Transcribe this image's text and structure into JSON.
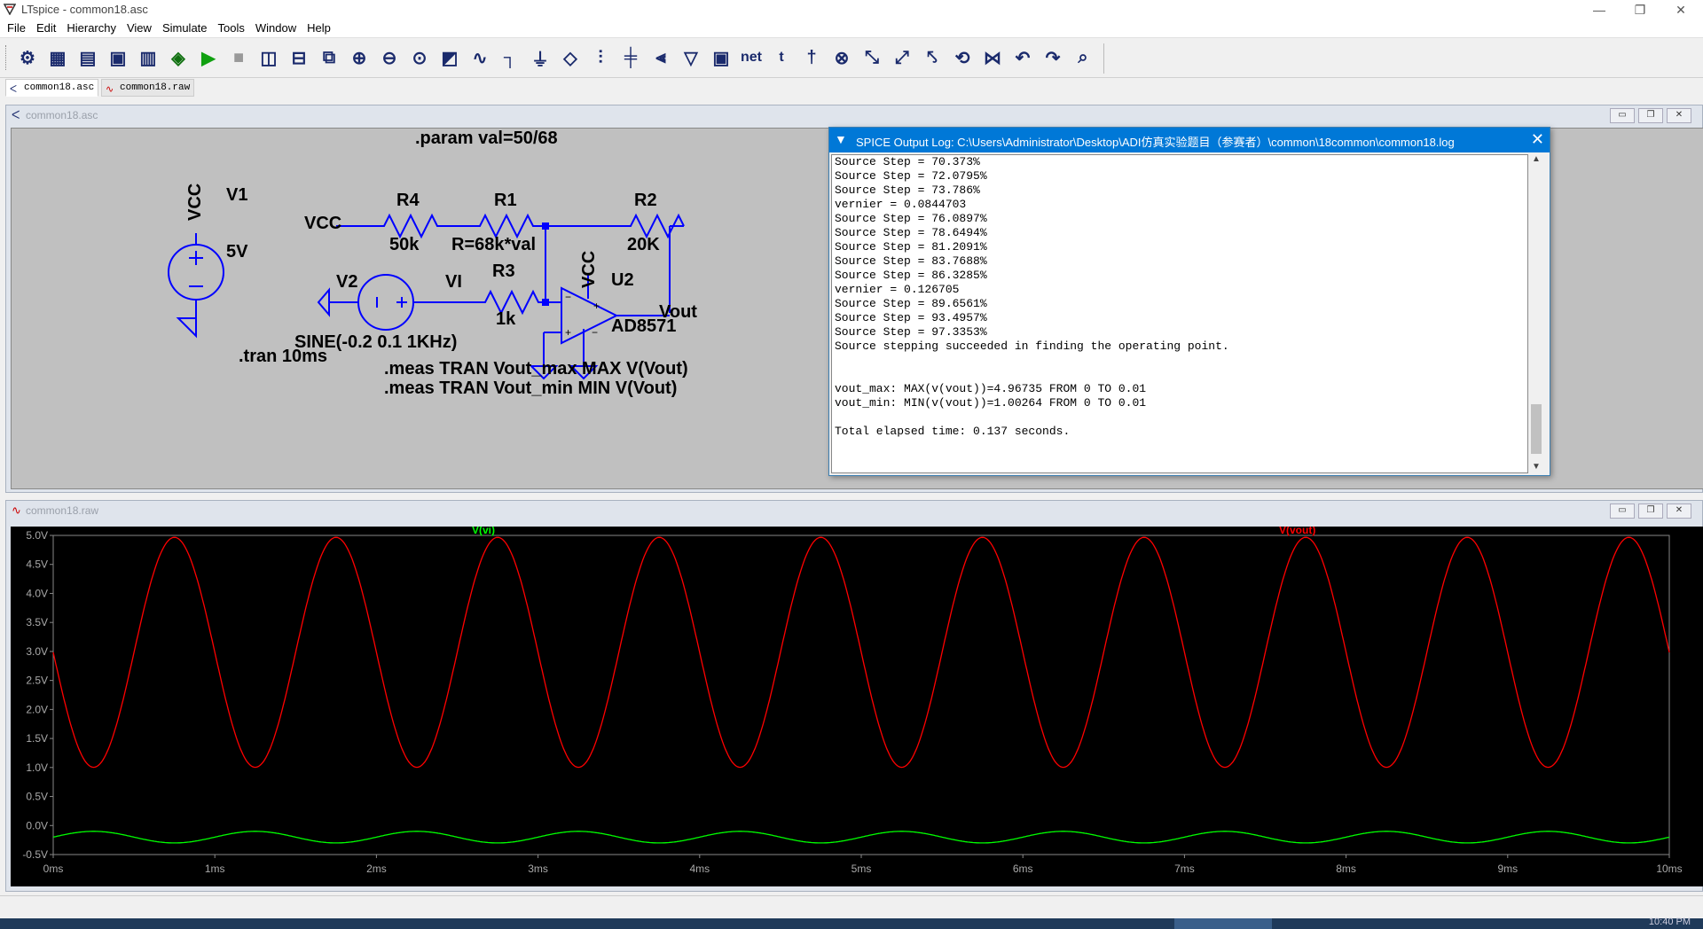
{
  "app": {
    "title": "LTspice - common18.asc",
    "menu": [
      "File",
      "Edit",
      "Hierarchy",
      "View",
      "Simulate",
      "Tools",
      "Window",
      "Help"
    ]
  },
  "toolbar": {
    "icons": [
      "settings-icon",
      "open-schematic-icon",
      "open-file-icon",
      "save-icon",
      "print-icon",
      "control-panel-icon",
      "run-icon",
      "halt-icon",
      "tile-vertical-icon",
      "tile-horizontal-icon",
      "cascade-icon",
      "zoom-in-icon",
      "zoom-out-icon",
      "zoom-fit-icon",
      "autorange-icon",
      "waveform-icon",
      "wire-icon",
      "ground-icon",
      "label-net-icon",
      "resistor-icon",
      "capacitor-icon",
      "inductor-icon",
      "diode-icon",
      "component-icon",
      "net-label-icon",
      "text-icon",
      "spice-directive-icon",
      "delete-icon",
      "duplicate-icon",
      "move-icon",
      "drag-icon",
      "rotate-icon",
      "mirror-icon",
      "undo-icon",
      "redo-icon",
      "find-icon"
    ],
    "glyphs": [
      "⚙",
      "▦",
      "▤",
      "▣",
      "▥",
      "◈",
      "▶",
      "■",
      "◫",
      "⊟",
      "⧉",
      "⊕",
      "⊖",
      "⊙",
      "◩",
      "∿",
      "┐",
      "⏚",
      "◇",
      "⫶",
      "╪",
      "⫷",
      "▽",
      "▣",
      "net",
      "t",
      "†",
      "⊗",
      "⤡",
      "⤢",
      "⤣",
      "⟲",
      "⋈",
      "↶",
      "↷",
      "⌕"
    ]
  },
  "tabs": [
    {
      "label": "common18.asc",
      "icon": "schematic-icon"
    },
    {
      "label": "common18.raw",
      "icon": "waveform-icon"
    }
  ],
  "schematic_window": {
    "title": "common18.asc"
  },
  "plot_window": {
    "title": "common18.raw"
  },
  "schematic": {
    "param": ".param val=50/68",
    "vcc_label": "VCC",
    "v1_name": "V1",
    "v1_value": "5V",
    "v1_net": "VCC",
    "r4_name": "R4",
    "r4_value": "50k",
    "r1_name": "R1",
    "r1_value": "R=68k*val",
    "r2_name": "R2",
    "r2_value": "20K",
    "v2_name": "V2",
    "v2_value": "SINE(-0.2 0.1 1KHz)",
    "vi_net": "VI",
    "r3_name": "R3",
    "r3_value": "1k",
    "u2_name": "U2",
    "u2_vcc": "VCC",
    "u2_model": "AD8571",
    "vout_net": "Vout",
    "tran": ".tran 10ms",
    "meas1": ".meas TRAN Vout_max MAX V(Vout)",
    "meas2": ".meas TRAN Vout_min MIN V(Vout)"
  },
  "log": {
    "title": "SPICE Output Log: C:\\Users\\Administrator\\Desktop\\ADI仿真实验题目（参赛者）\\common\\18common\\common18.log",
    "lines": [
      "Source Step = 70.373%",
      "Source Step = 72.0795%",
      "Source Step = 73.786%",
      "vernier = 0.0844703",
      "Source Step = 76.0897%",
      "Source Step = 78.6494%",
      "Source Step = 81.2091%",
      "Source Step = 83.7688%",
      "Source Step = 86.3285%",
      "vernier = 0.126705",
      "Source Step = 89.6561%",
      "Source Step = 93.4957%",
      "Source Step = 97.3353%",
      "Source stepping succeeded in finding the operating point.",
      "",
      "",
      "vout_max: MAX(v(vout))=4.96735 FROM 0 TO 0.01",
      "vout_min: MIN(v(vout))=1.00264 FROM 0 TO 0.01",
      "",
      "Total elapsed time: 0.137 seconds."
    ]
  },
  "chart_data": {
    "type": "line",
    "x_unit": "ms",
    "xlim": [
      0,
      10
    ],
    "ylim": [
      -0.5,
      5.0
    ],
    "x_ticks": [
      "0ms",
      "1ms",
      "2ms",
      "3ms",
      "4ms",
      "5ms",
      "6ms",
      "7ms",
      "8ms",
      "9ms",
      "10ms"
    ],
    "y_ticks": [
      "5.0V",
      "4.5V",
      "4.0V",
      "3.5V",
      "3.0V",
      "2.5V",
      "2.0V",
      "1.5V",
      "1.0V",
      "0.5V",
      "0.0V",
      "-0.5V"
    ],
    "grid": false,
    "series": [
      {
        "name": "V(vi)",
        "color": "#00ff00",
        "kind": "sine",
        "offset": -0.2,
        "amplitude": 0.1,
        "freq_khz": 1,
        "phase_deg": 0
      },
      {
        "name": "V(vout)",
        "color": "#ff0000",
        "kind": "sine",
        "offset": 2.985,
        "amplitude": 1.982,
        "freq_khz": 1,
        "phase_deg": 180
      }
    ]
  },
  "colors": {
    "plot_bg": "#000000",
    "wire": "#0000ff",
    "log_title_bg": "#0078d7",
    "schematic_bg": "#c0c0c0"
  },
  "taskbar": {
    "clock": "10:40 PM"
  }
}
